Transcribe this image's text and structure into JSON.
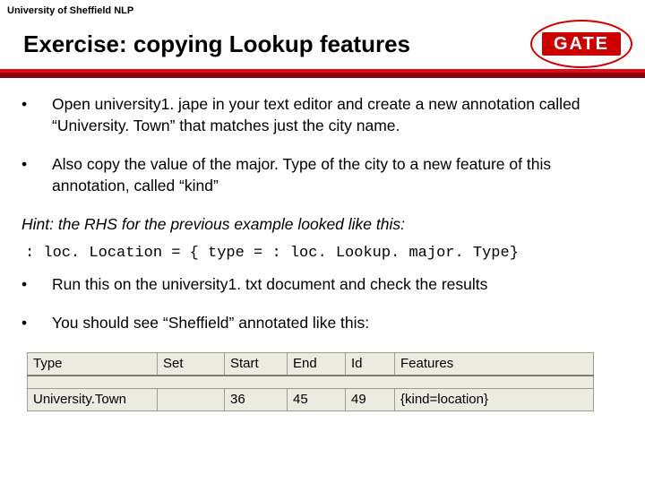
{
  "org": "University of Sheffield NLP",
  "logo": "GATE",
  "title": "Exercise: copying Lookup features",
  "bullets1": [
    "Open university1. jape in your text editor and create a new annotation called “University. Town” that matches just the city name.",
    "Also copy the value of the major. Type of the city to a new feature of this annotation, called “kind”"
  ],
  "hint": "Hint: the RHS for the previous example looked like this:",
  "code": ": loc. Location = { type = : loc. Lookup. major. Type}",
  "bullets2": [
    "Run this on the university1. txt document and check the results",
    "You should see “Sheffield” annotated like this:"
  ],
  "table": {
    "headers": [
      "Type",
      "Set",
      "Start",
      "End",
      "Id",
      "Features"
    ],
    "row": {
      "type": "University.Town",
      "set": "",
      "start": "36",
      "end": "45",
      "id": "49",
      "features": "{kind=location}"
    }
  }
}
